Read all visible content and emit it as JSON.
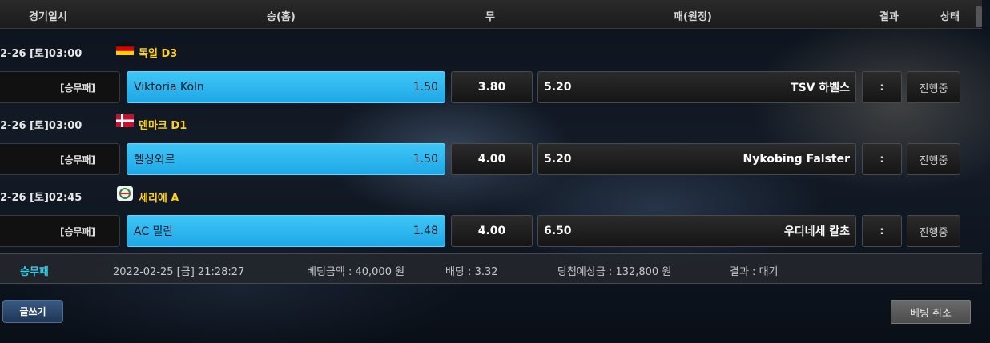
{
  "header": {
    "col_date": "경기일시",
    "col_home": "승(홈)",
    "col_draw": "무",
    "col_away": "패(원정)",
    "col_result": "결과",
    "col_status": "상태"
  },
  "matches": [
    {
      "datetime": "2-26 [토]03:00",
      "league": "독일 D3",
      "flag_icon": "germany-flag-icon",
      "bet_type": "[승무패]",
      "home_team": "Viktoria Köln",
      "home_odds": "1.50",
      "draw_odds": "3.80",
      "away_odds": "5.20",
      "away_team": "TSV 하벨스",
      "result": ":",
      "status": "진행중"
    },
    {
      "datetime": "2-26 [토]03:00",
      "league": "덴마크 D1",
      "flag_icon": "denmark-flag-icon",
      "bet_type": "[승무패]",
      "home_team": "헬싱외르",
      "home_odds": "1.50",
      "draw_odds": "4.00",
      "away_odds": "5.20",
      "away_team": "Nykobing Falster",
      "result": ":",
      "status": "진행중"
    },
    {
      "datetime": "2-26 [토]02:45",
      "league": "세리에 A",
      "flag_icon": "serie-a-logo-icon",
      "bet_type": "[승무패]",
      "home_team": "AC 밀란",
      "home_odds": "1.48",
      "draw_odds": "4.00",
      "away_odds": "6.50",
      "away_team": "우디네세 칼초",
      "result": ":",
      "status": "진행중"
    }
  ],
  "summary": {
    "bet_type": "승무패",
    "datetime": "2022-02-25 [금] 21:28:27",
    "bet_amount": "베팅금액 : 40,000 원",
    "odds": "배당 : 3.32",
    "expected_win": "당첨예상금 : 132,800 원",
    "result": "결과 : 대기"
  },
  "buttons": {
    "write": "글쓰기",
    "cancel": "베팅 취소"
  },
  "colors": {
    "home_selected": "#1ea7e6",
    "league_text": "#ffd11a",
    "summary_type": "#2ed0e8"
  }
}
